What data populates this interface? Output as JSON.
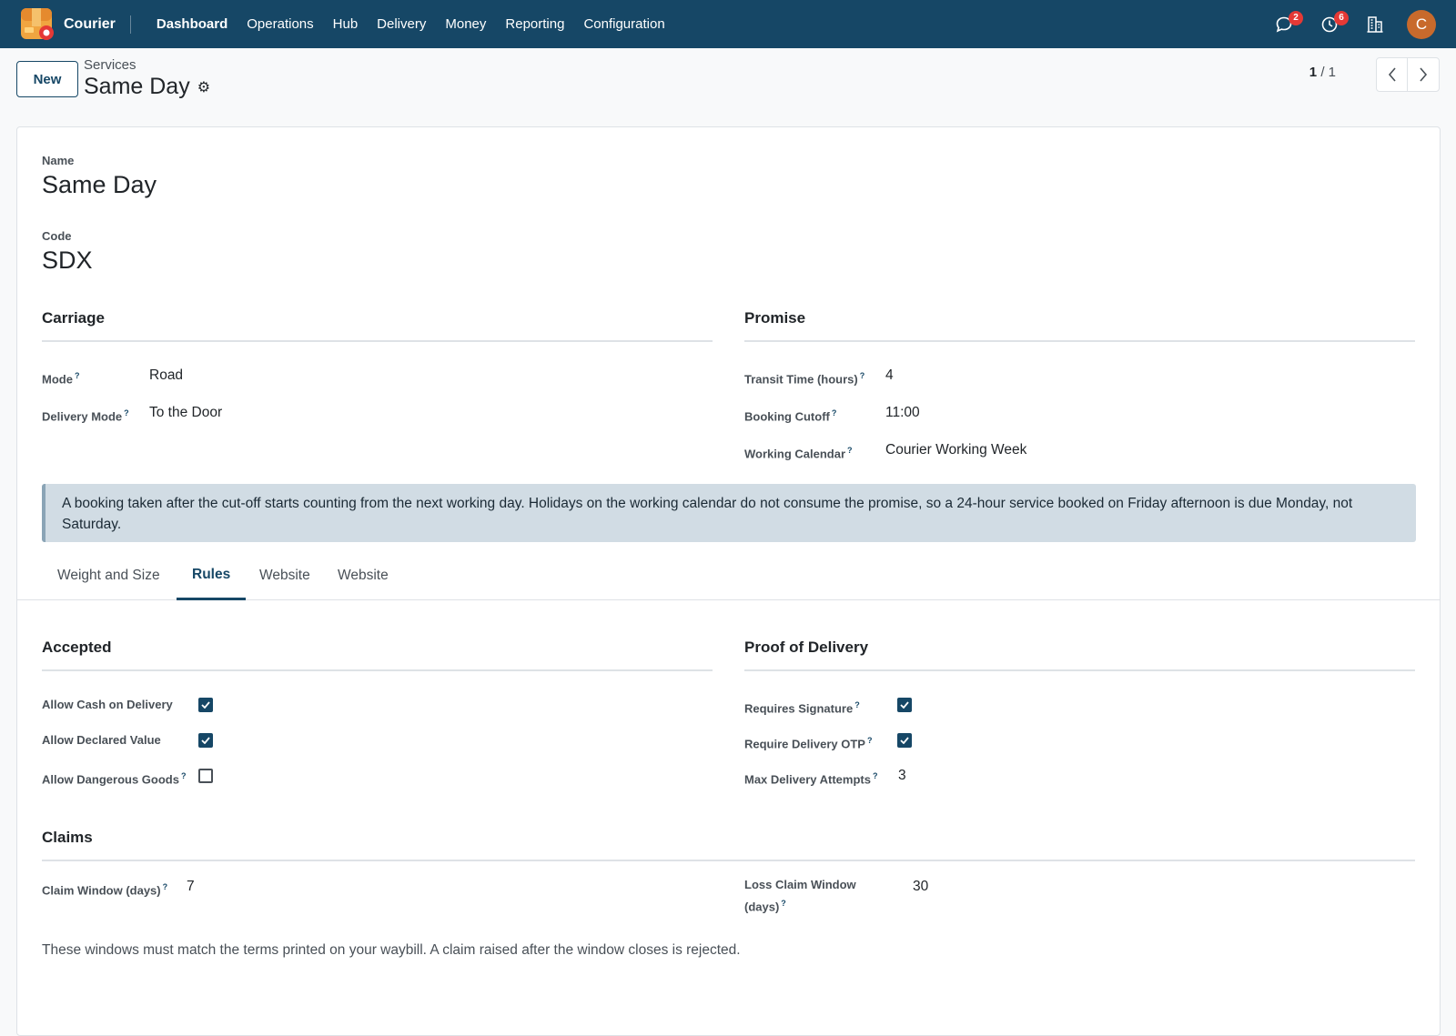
{
  "nav": {
    "brand": "Courier",
    "menu": [
      "Dashboard",
      "Operations",
      "Hub",
      "Delivery",
      "Money",
      "Reporting",
      "Configuration"
    ],
    "messages_badge": "2",
    "activity_badge": "6",
    "avatar_initial": "C",
    "colors": {
      "bar": "#164766",
      "avatar": "#c86a2c",
      "badge": "#e53935"
    }
  },
  "control": {
    "new_label": "New",
    "breadcrumb_parent": "Services",
    "breadcrumb_current": "Same Day",
    "pager_current": "1",
    "pager_total": "/ 1"
  },
  "form": {
    "name_label": "Name",
    "name_value": "Same Day",
    "code_label": "Code",
    "code_value": "SDX",
    "carriage": {
      "title": "Carriage",
      "mode_label": "Mode",
      "mode_value": "Road",
      "delivery_mode_label": "Delivery Mode",
      "delivery_mode_value": "To the Door"
    },
    "promise": {
      "title": "Promise",
      "transit_label": "Transit Time (hours)",
      "transit_value": "4",
      "cutoff_label": "Booking Cutoff",
      "cutoff_value": "11:00",
      "calendar_label": "Working Calendar",
      "calendar_value": "Courier Working Week"
    },
    "alert": "A booking taken after the cut-off starts counting from the next working day. Holidays on the working calendar do not consume the promise, so a 24-hour service booked on Friday afternoon is due Monday, not Saturday.",
    "tabs": [
      "Weight and Size",
      "Rules",
      "Website",
      "Website"
    ],
    "active_tab": "Rules",
    "accepted": {
      "title": "Accepted",
      "cod_label": "Allow Cash on Delivery",
      "cod_checked": true,
      "declared_label": "Allow Declared Value",
      "declared_checked": true,
      "dangerous_label": "Allow Dangerous Goods",
      "dangerous_checked": false
    },
    "pod": {
      "title": "Proof of Delivery",
      "signature_label": "Requires Signature",
      "signature_checked": true,
      "otp_label": "Require Delivery OTP",
      "otp_checked": true,
      "attempts_label": "Max Delivery Attempts",
      "attempts_value": "3"
    },
    "claims": {
      "title": "Claims",
      "window_label": "Claim Window (days)",
      "window_value": "7",
      "loss_label_1": "Loss Claim Window",
      "loss_label_2": "(days)",
      "loss_value": "30",
      "note": "These windows must match the terms printed on your waybill. A claim raised after the window closes is rejected."
    },
    "help_mark": "?"
  }
}
